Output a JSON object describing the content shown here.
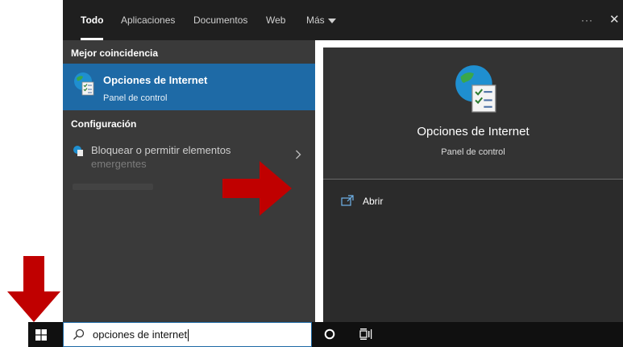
{
  "tabs": [
    {
      "label": "Todo",
      "active": true
    },
    {
      "label": "Aplicaciones"
    },
    {
      "label": "Documentos"
    },
    {
      "label": "Web"
    },
    {
      "label": "Más"
    }
  ],
  "window_controls": {
    "more": "···",
    "close": "✕"
  },
  "best_match": {
    "header": "Mejor coincidencia",
    "title": "Opciones de Internet",
    "subtitle": "Panel de control"
  },
  "settings": {
    "header": "Configuración",
    "item_line1": "Bloquear o permitir elementos",
    "item_line2": "emergentes"
  },
  "preview": {
    "title": "Opciones de Internet",
    "subtitle": "Panel de control",
    "action_open": "Abrir"
  },
  "taskbar": {
    "search_value": "opciones de internet"
  },
  "colors": {
    "highlight": "#1e6aa6",
    "annotation_arrow": "#c00000",
    "pane_dark": "#2b2b2b",
    "pane_left": "#3a3a3a"
  },
  "icons": [
    "internet-options-icon",
    "windows-start-icon",
    "search-icon",
    "cortana-circle-icon",
    "task-view-icon",
    "open-app-icon",
    "chevron-right-icon"
  ]
}
